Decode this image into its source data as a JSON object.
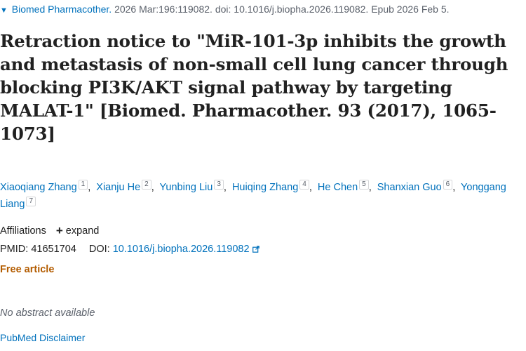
{
  "citation": {
    "journal": "Biomed Pharmacother.",
    "details": " 2026 Mar:196:119082. doi: 10.1016/j.biopha.2026.119082. Epub 2026 Feb 5."
  },
  "title": "Retraction notice to \"MiR-101-3p inhibits the growth and metastasis of non-small cell lung cancer through blocking PI3K/AKT signal pathway by targeting MALAT-1\" [Biomed. Pharmacother. 93 (2017), 1065-1073]",
  "authors": [
    {
      "name": "Xiaoqiang Zhang",
      "aff": "1"
    },
    {
      "name": "Xianju He",
      "aff": "2"
    },
    {
      "name": "Yunbing Liu",
      "aff": "3"
    },
    {
      "name": "Huiqing Zhang",
      "aff": "4"
    },
    {
      "name": "He Chen",
      "aff": "5"
    },
    {
      "name": "Shanxian Guo",
      "aff": "6"
    },
    {
      "name": "Yonggang Liang",
      "aff": "7"
    }
  ],
  "affiliations": {
    "label": "Affiliations",
    "expand_label": "expand"
  },
  "ids": {
    "pmid_label": "PMID:",
    "pmid": "41651704",
    "doi_label": "DOI:",
    "doi": "10.1016/j.biopha.2026.119082"
  },
  "free_label": "Free article",
  "no_abstract": "No abstract available",
  "disclaimer": "PubMed Disclaimer",
  "icons": {
    "journal_toggle": "triangle-down-icon",
    "expand": "plus-icon",
    "external": "external-link-icon"
  },
  "colors": {
    "link": "#0071bc",
    "free": "#b35c00",
    "muted": "#5b616b",
    "text": "#212121"
  }
}
